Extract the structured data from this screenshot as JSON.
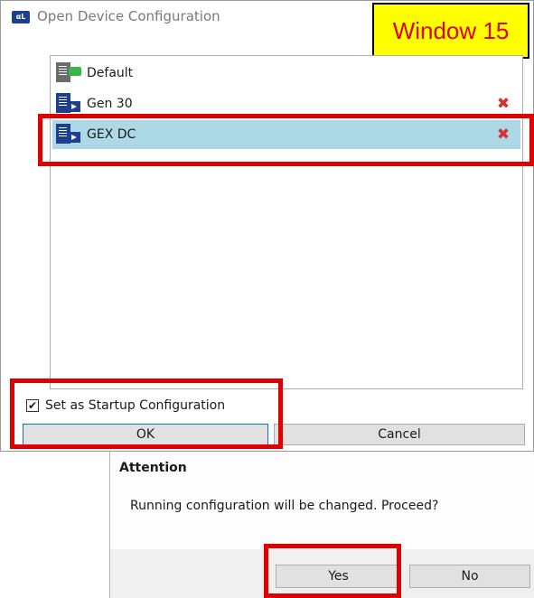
{
  "window": {
    "title": "Open Device Configuration",
    "icon": "app-logo-icon",
    "annotation_label": "Window 15"
  },
  "configs": [
    {
      "label": "Default",
      "icon": "config-default-icon",
      "deletable": false,
      "selected": false
    },
    {
      "label": "Gen 30",
      "icon": "config-file-icon",
      "deletable": true,
      "selected": false
    },
    {
      "label": "GEX DC",
      "icon": "config-file-icon",
      "deletable": true,
      "selected": true
    }
  ],
  "startup": {
    "label": "Set as Startup Configuration",
    "checked": true
  },
  "buttons": {
    "ok": "OK",
    "cancel": "Cancel"
  },
  "attention": {
    "title": "Attention",
    "message": "Running configuration will be changed. Proceed?",
    "yes": "Yes",
    "no": "No"
  },
  "colors": {
    "selection": "#add8e6",
    "highlight": "#e00000",
    "annotation_bg": "#ffff00",
    "delete_icon": "#d8312f"
  }
}
